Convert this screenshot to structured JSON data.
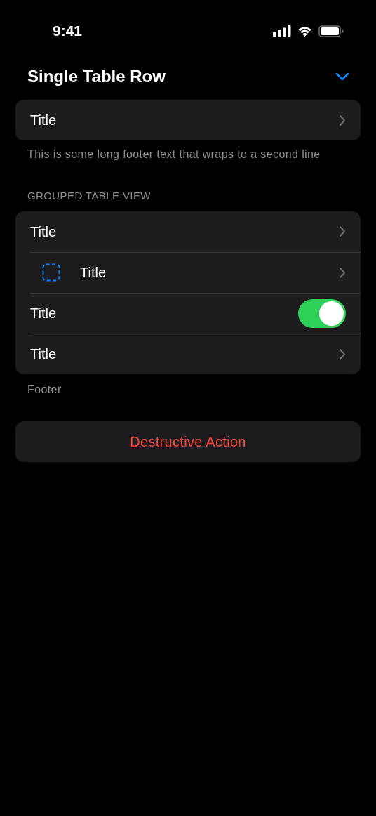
{
  "status_bar": {
    "time": "9:41"
  },
  "header": {
    "title": "Single Table Row"
  },
  "single_section": {
    "rows": [
      {
        "kind": "disclosure",
        "title": "Title"
      }
    ],
    "footer": "This is some long footer text that wraps to a second line"
  },
  "grouped_section": {
    "header": "GROUPED TABLE VIEW",
    "rows": [
      {
        "kind": "disclosure",
        "title": "Title"
      },
      {
        "kind": "icon_disclosure",
        "title": "Title"
      },
      {
        "kind": "toggle",
        "title": "Title",
        "on": true
      },
      {
        "kind": "disclosure",
        "title": "Title"
      }
    ],
    "footer": "Footer"
  },
  "destructive_button": {
    "label": "Destructive Action"
  }
}
